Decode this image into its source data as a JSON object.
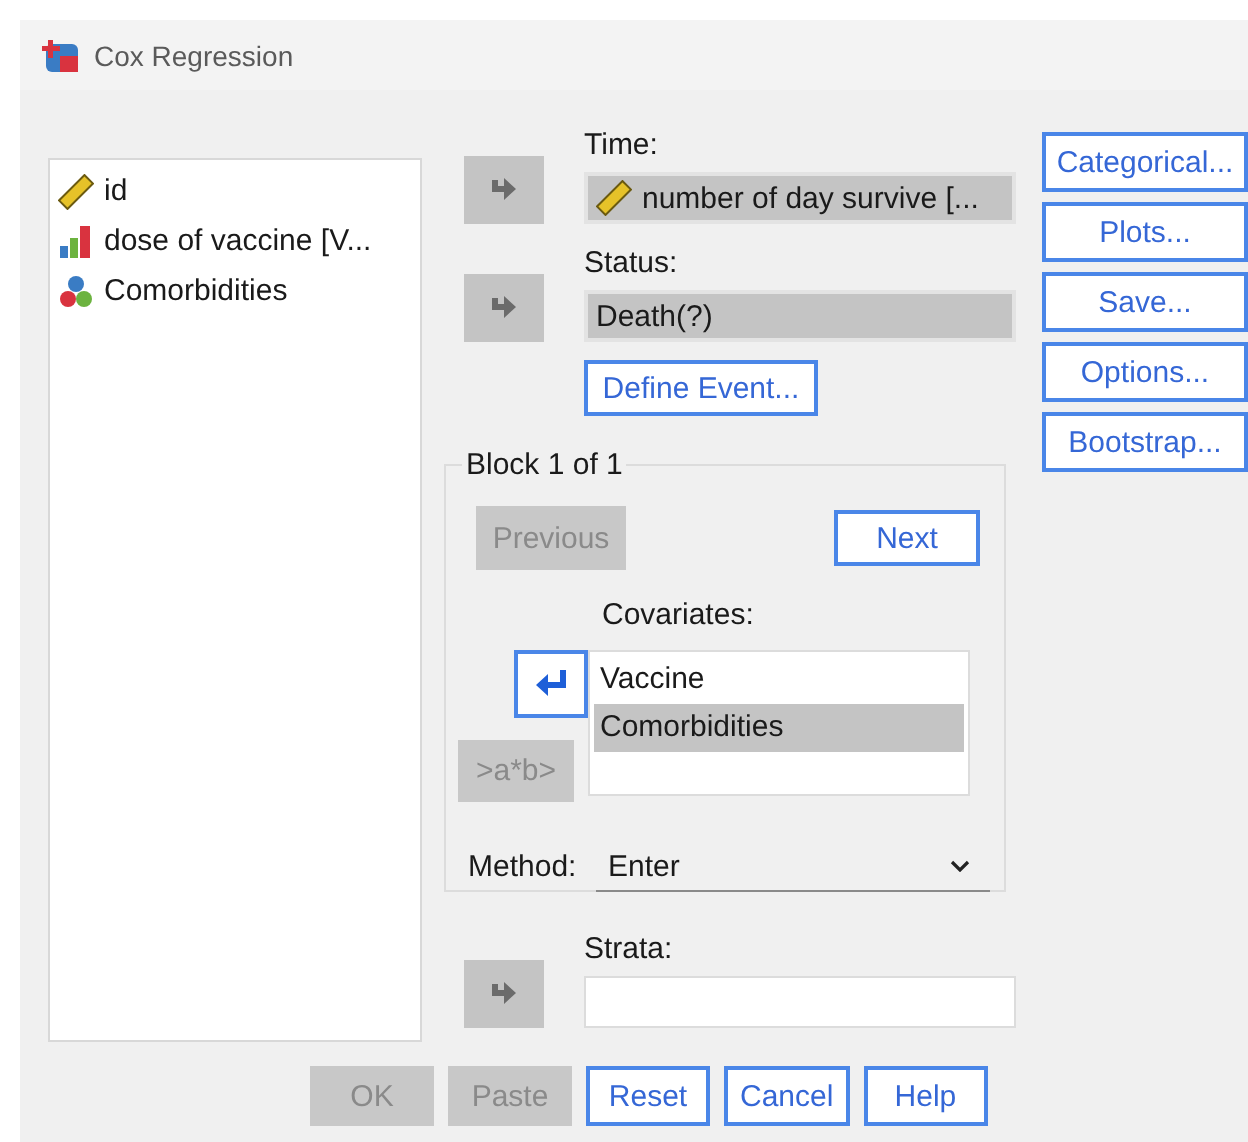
{
  "window": {
    "title": "Cox Regression"
  },
  "variables": [
    {
      "name": "id",
      "kind": "scale"
    },
    {
      "name": "dose of vaccine [V...",
      "kind": "ordinal"
    },
    {
      "name": "Comorbidities",
      "kind": "nominal"
    }
  ],
  "time": {
    "label": "Time:",
    "value": "number of day survive [...",
    "kind": "scale",
    "arrow": {
      "enabled": false,
      "kind": "add"
    }
  },
  "status": {
    "label": "Status:",
    "value": "Death(?)",
    "arrow": {
      "enabled": false,
      "kind": "add"
    }
  },
  "define_event": {
    "label": "Define Event...",
    "disabled": false
  },
  "block": {
    "title": "Block 1 of 1",
    "previous": {
      "label": "Previous",
      "disabled": true
    },
    "next": {
      "label": "Next",
      "disabled": false
    },
    "covariates_label": "Covariates:",
    "arrow": {
      "enabled": true,
      "kind": "remove"
    },
    "interaction": {
      "label": ">a*b>",
      "disabled": true
    },
    "covariates": [
      {
        "name": "Vaccine",
        "selected": false
      },
      {
        "name": "Comorbidities",
        "selected": true
      }
    ],
    "method_label": "Method:",
    "method": "Enter"
  },
  "strata": {
    "label": "Strata:",
    "arrow": {
      "enabled": false,
      "kind": "add"
    }
  },
  "side_buttons": [
    {
      "label": "Categorical..."
    },
    {
      "label": "Plots..."
    },
    {
      "label": "Save..."
    },
    {
      "label": "Options..."
    },
    {
      "label": "Bootstrap..."
    }
  ],
  "buttons": [
    {
      "label": "OK",
      "disabled": true
    },
    {
      "label": "Paste",
      "disabled": true
    },
    {
      "label": "Reset",
      "disabled": false
    },
    {
      "label": "Cancel",
      "disabled": false
    },
    {
      "label": "Help",
      "disabled": false
    }
  ]
}
